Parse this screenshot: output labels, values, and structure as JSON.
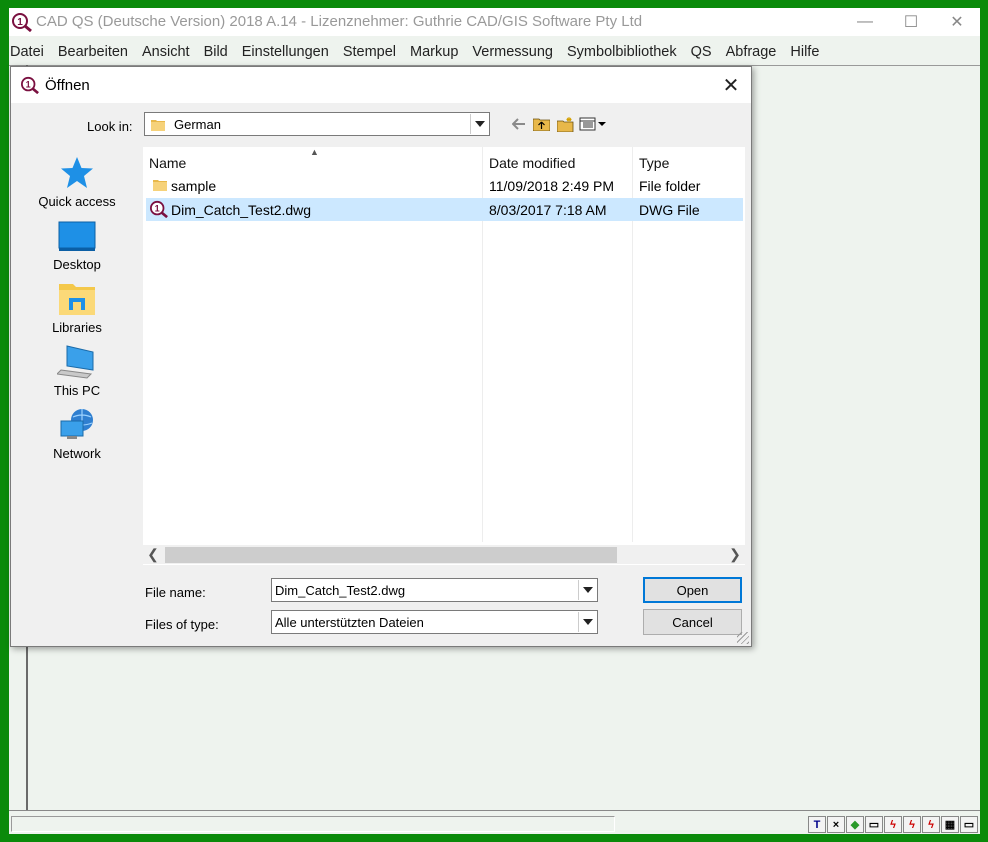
{
  "app": {
    "title": "CAD QS (Deutsche Version) 2018 A.14 - Lizenznehmer: Guthrie CAD/GIS Software Pty Ltd",
    "window_controls": {
      "minimize": "—",
      "maximize": "☐",
      "close": "✕"
    },
    "menu": [
      "Datei",
      "Bearbeiten",
      "Ansicht",
      "Bild",
      "Einstellungen",
      "Stempel",
      "Markup",
      "Vermessung",
      "Symbolbibliothek",
      "QS",
      "Abfrage",
      "Hilfe"
    ],
    "status_icons": [
      "T",
      "×",
      "◆",
      "▭",
      "ϟ",
      "ϟ",
      "ϟ",
      "▦",
      "▭"
    ]
  },
  "dialog": {
    "title": "Öffnen",
    "close_glyph": "✕",
    "look_in_label": "Look in:",
    "look_in_value": "German",
    "places": [
      {
        "label": "Quick access",
        "icon": "star-icon"
      },
      {
        "label": "Desktop",
        "icon": "desktop-icon"
      },
      {
        "label": "Libraries",
        "icon": "libraries-icon"
      },
      {
        "label": "This PC",
        "icon": "computer-icon"
      },
      {
        "label": "Network",
        "icon": "network-icon"
      }
    ],
    "columns": {
      "name": "Name",
      "date": "Date modified",
      "type": "Type"
    },
    "files": [
      {
        "name": "sample",
        "date": "11/09/2018 2:49 PM",
        "type": "File folder",
        "icon": "folder-icon",
        "selected": false
      },
      {
        "name": "Dim_Catch_Test2.dwg",
        "date": "8/03/2017 7:18 AM",
        "type": "DWG File",
        "icon": "dwg-file-icon",
        "selected": true
      }
    ],
    "file_name_label": "File name:",
    "file_name_value": "Dim_Catch_Test2.dwg",
    "file_type_label": "Files of type:",
    "file_type_value": "Alle unterstützten Dateien",
    "open_label": "Open",
    "cancel_label": "Cancel"
  },
  "colors": {
    "frame": "#0a8a0a",
    "selection": "#cce8ff",
    "accent": "#0078d7"
  }
}
